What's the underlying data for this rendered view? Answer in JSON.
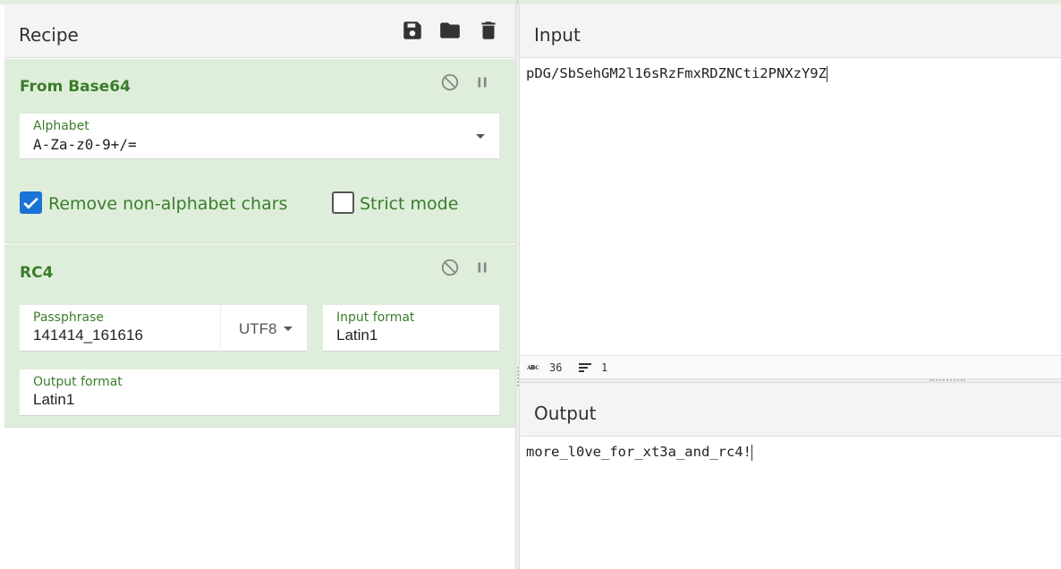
{
  "recipe": {
    "title": "Recipe",
    "icons": [
      "save-icon",
      "folder-icon",
      "trash-icon"
    ],
    "operations": [
      {
        "name": "From Base64",
        "alphabet_label": "Alphabet",
        "alphabet_value": "A-Za-z0-9+/=",
        "remove_nonalpha_label": "Remove non-alphabet chars",
        "remove_nonalpha_checked": true,
        "strict_mode_label": "Strict mode",
        "strict_mode_checked": false
      },
      {
        "name": "RC4",
        "passphrase_label": "Passphrase",
        "passphrase_value": "141414_161616",
        "passphrase_encoding": "UTF8",
        "input_format_label": "Input format",
        "input_format_value": "Latin1",
        "output_format_label": "Output format",
        "output_format_value": "Latin1"
      }
    ]
  },
  "input": {
    "title": "Input",
    "text": "pDG/SbSehGM2l16sRzFmxRDZNCti2PNXzY9Z",
    "status": {
      "length": "36",
      "lines": "1"
    }
  },
  "output": {
    "title": "Output",
    "text": "more_l0ve_for_xt3a_and_rc4!"
  },
  "colors": {
    "accent_green": "#3a7d2c",
    "operation_bg": "#dfeedb",
    "checkbox_blue": "#1a73d6"
  }
}
